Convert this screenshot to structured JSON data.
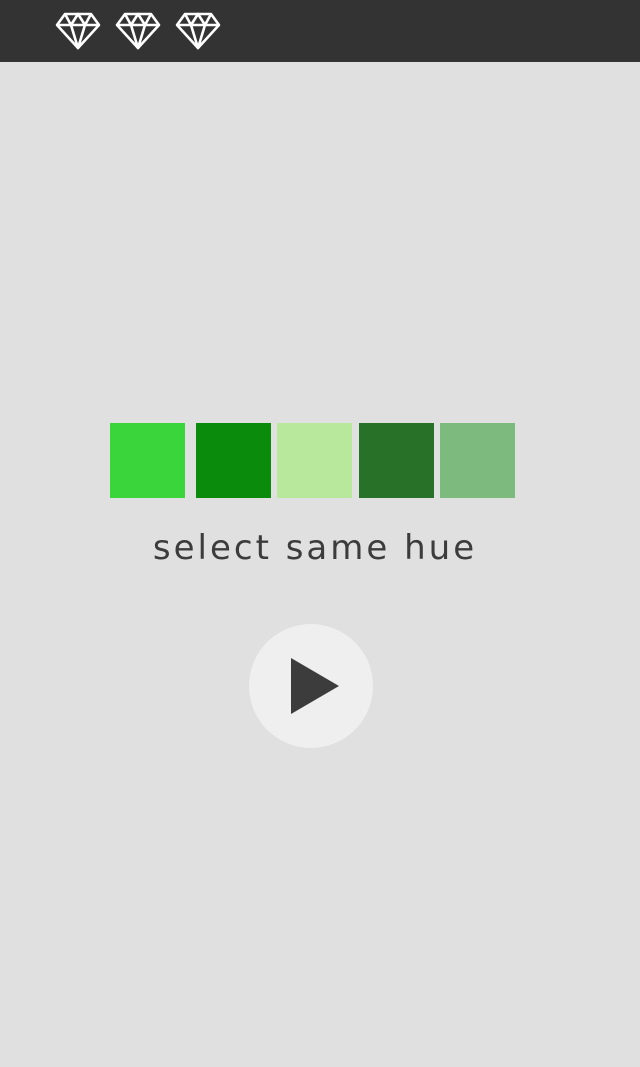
{
  "lives": {
    "count": 3,
    "icon": "diamond-icon",
    "color": "#ffffff"
  },
  "header": {
    "background": "#333333"
  },
  "swatches": [
    {
      "color": "#3ad53a"
    },
    {
      "color": "#0b8b0b"
    },
    {
      "color": "#b7e89c"
    },
    {
      "color": "#287128"
    },
    {
      "color": "#7dba7d"
    }
  ],
  "instruction": "select same hue",
  "play_button": {
    "icon": "play-icon",
    "icon_color": "#3c3c3c",
    "background": "#efefef"
  },
  "background": "#e0e0e0"
}
